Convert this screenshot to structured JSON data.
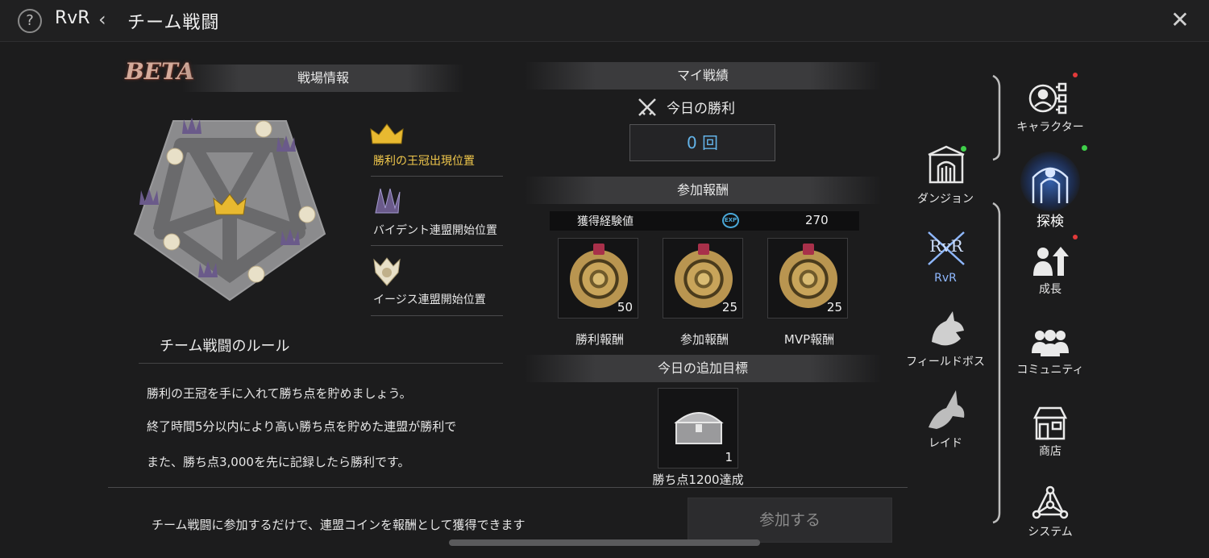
{
  "header": {
    "root": "RvR",
    "title": "チーム戦闘"
  },
  "battlefield": {
    "badge": "BETA",
    "heading": "戦場情報",
    "legend": [
      {
        "label": "勝利の王冠出現位置",
        "color": "#f2c94c"
      },
      {
        "label": "バイデント連盟開始位置",
        "color": "#e6e6e6"
      },
      {
        "label": "イージス連盟開始位置",
        "color": "#e6e6e6"
      }
    ],
    "rules_title": "チーム戦闘のルール",
    "rules": [
      "勝利の王冠を手に入れて勝ち点を貯めましょう。",
      "終了時間5分以内により高い勝ち点を貯めた連盟が勝利で",
      "また、勝ち点3,000を先に記録したら勝利です。"
    ]
  },
  "my_record": {
    "heading": "マイ戦績",
    "today_wins_label": "今日の勝利",
    "today_wins_value": "0 回"
  },
  "rewards": {
    "heading": "参加報酬",
    "exp_label": "獲得経験値",
    "exp_icon_text": "EXP",
    "exp_value": "270",
    "items": [
      {
        "label": "勝利報酬",
        "qty": "50"
      },
      {
        "label": "参加報酬",
        "qty": "25"
      },
      {
        "label": "MVP報酬",
        "qty": "25"
      }
    ]
  },
  "extra_goal": {
    "heading": "今日の追加目標",
    "qty": "1",
    "label": "勝ち点1200達成"
  },
  "footer": {
    "note": "チーム戦闘に参加するだけで、連盟コインを報酬として獲得できます",
    "join_label": "参加する"
  },
  "sub_nav": {
    "items": [
      {
        "label": "ダンジョン"
      },
      {
        "label": "RvR",
        "active": true
      },
      {
        "label": "フィールドボス"
      },
      {
        "label": "レイド"
      }
    ]
  },
  "main_nav": {
    "items": [
      {
        "label": "キャラクター"
      },
      {
        "label": "探検",
        "active": true
      },
      {
        "label": "成長"
      },
      {
        "label": "コミュニティ"
      },
      {
        "label": "商店"
      },
      {
        "label": "システム"
      }
    ]
  },
  "colors": {
    "accent_blue": "#63b3e8",
    "gold": "#f2c94c",
    "rvr_active": "#8fb8ff",
    "notify_red": "#e23a3a",
    "notify_green": "#3fcf4a"
  }
}
